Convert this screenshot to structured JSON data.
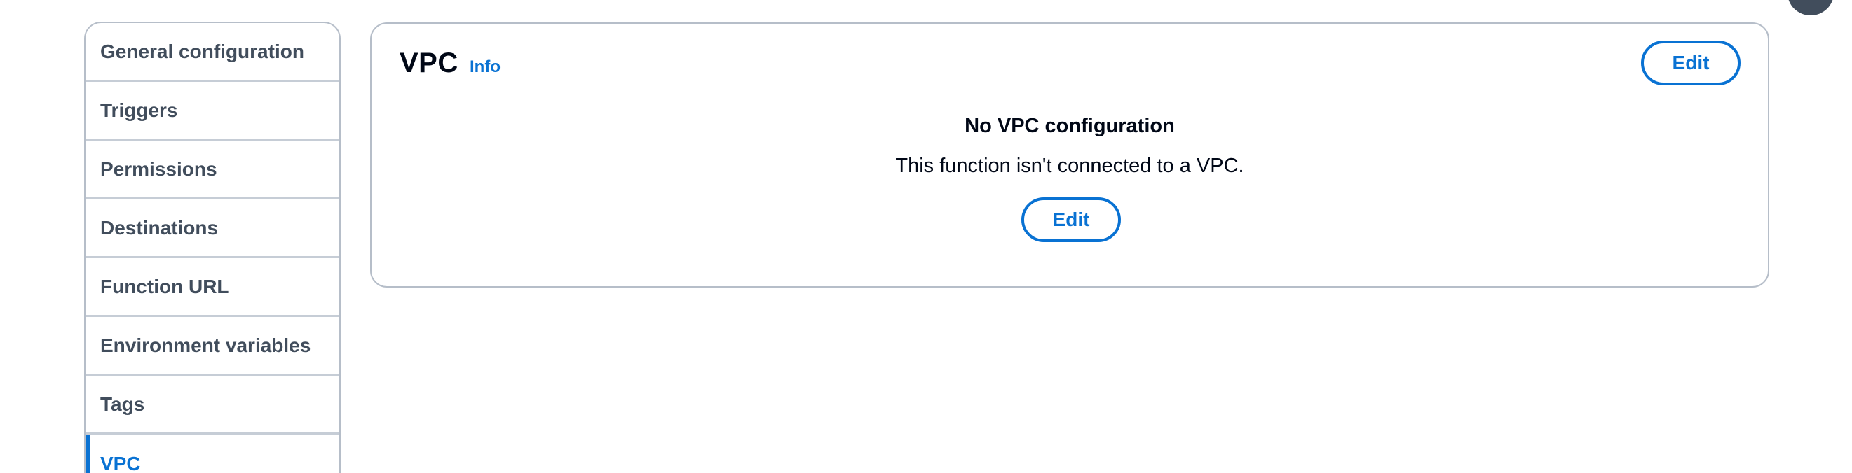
{
  "sidebar": {
    "items": [
      {
        "label": "General configuration",
        "active": false
      },
      {
        "label": "Triggers",
        "active": false
      },
      {
        "label": "Permissions",
        "active": false
      },
      {
        "label": "Destinations",
        "active": false
      },
      {
        "label": "Function URL",
        "active": false
      },
      {
        "label": "Environment variables",
        "active": false
      },
      {
        "label": "Tags",
        "active": false
      },
      {
        "label": "VPC",
        "active": true
      }
    ]
  },
  "panel": {
    "title": "VPC",
    "info_link": "Info",
    "edit_label": "Edit",
    "empty_state": {
      "title": "No VPC configuration",
      "description": "This function isn't connected to a VPC.",
      "action_label": "Edit"
    }
  },
  "colors": {
    "accent": "#0972d3",
    "text": "#000716",
    "muted_text": "#414d5c",
    "border": "#b6bec9"
  },
  "icons": {
    "floating_button": "feedback-icon"
  }
}
